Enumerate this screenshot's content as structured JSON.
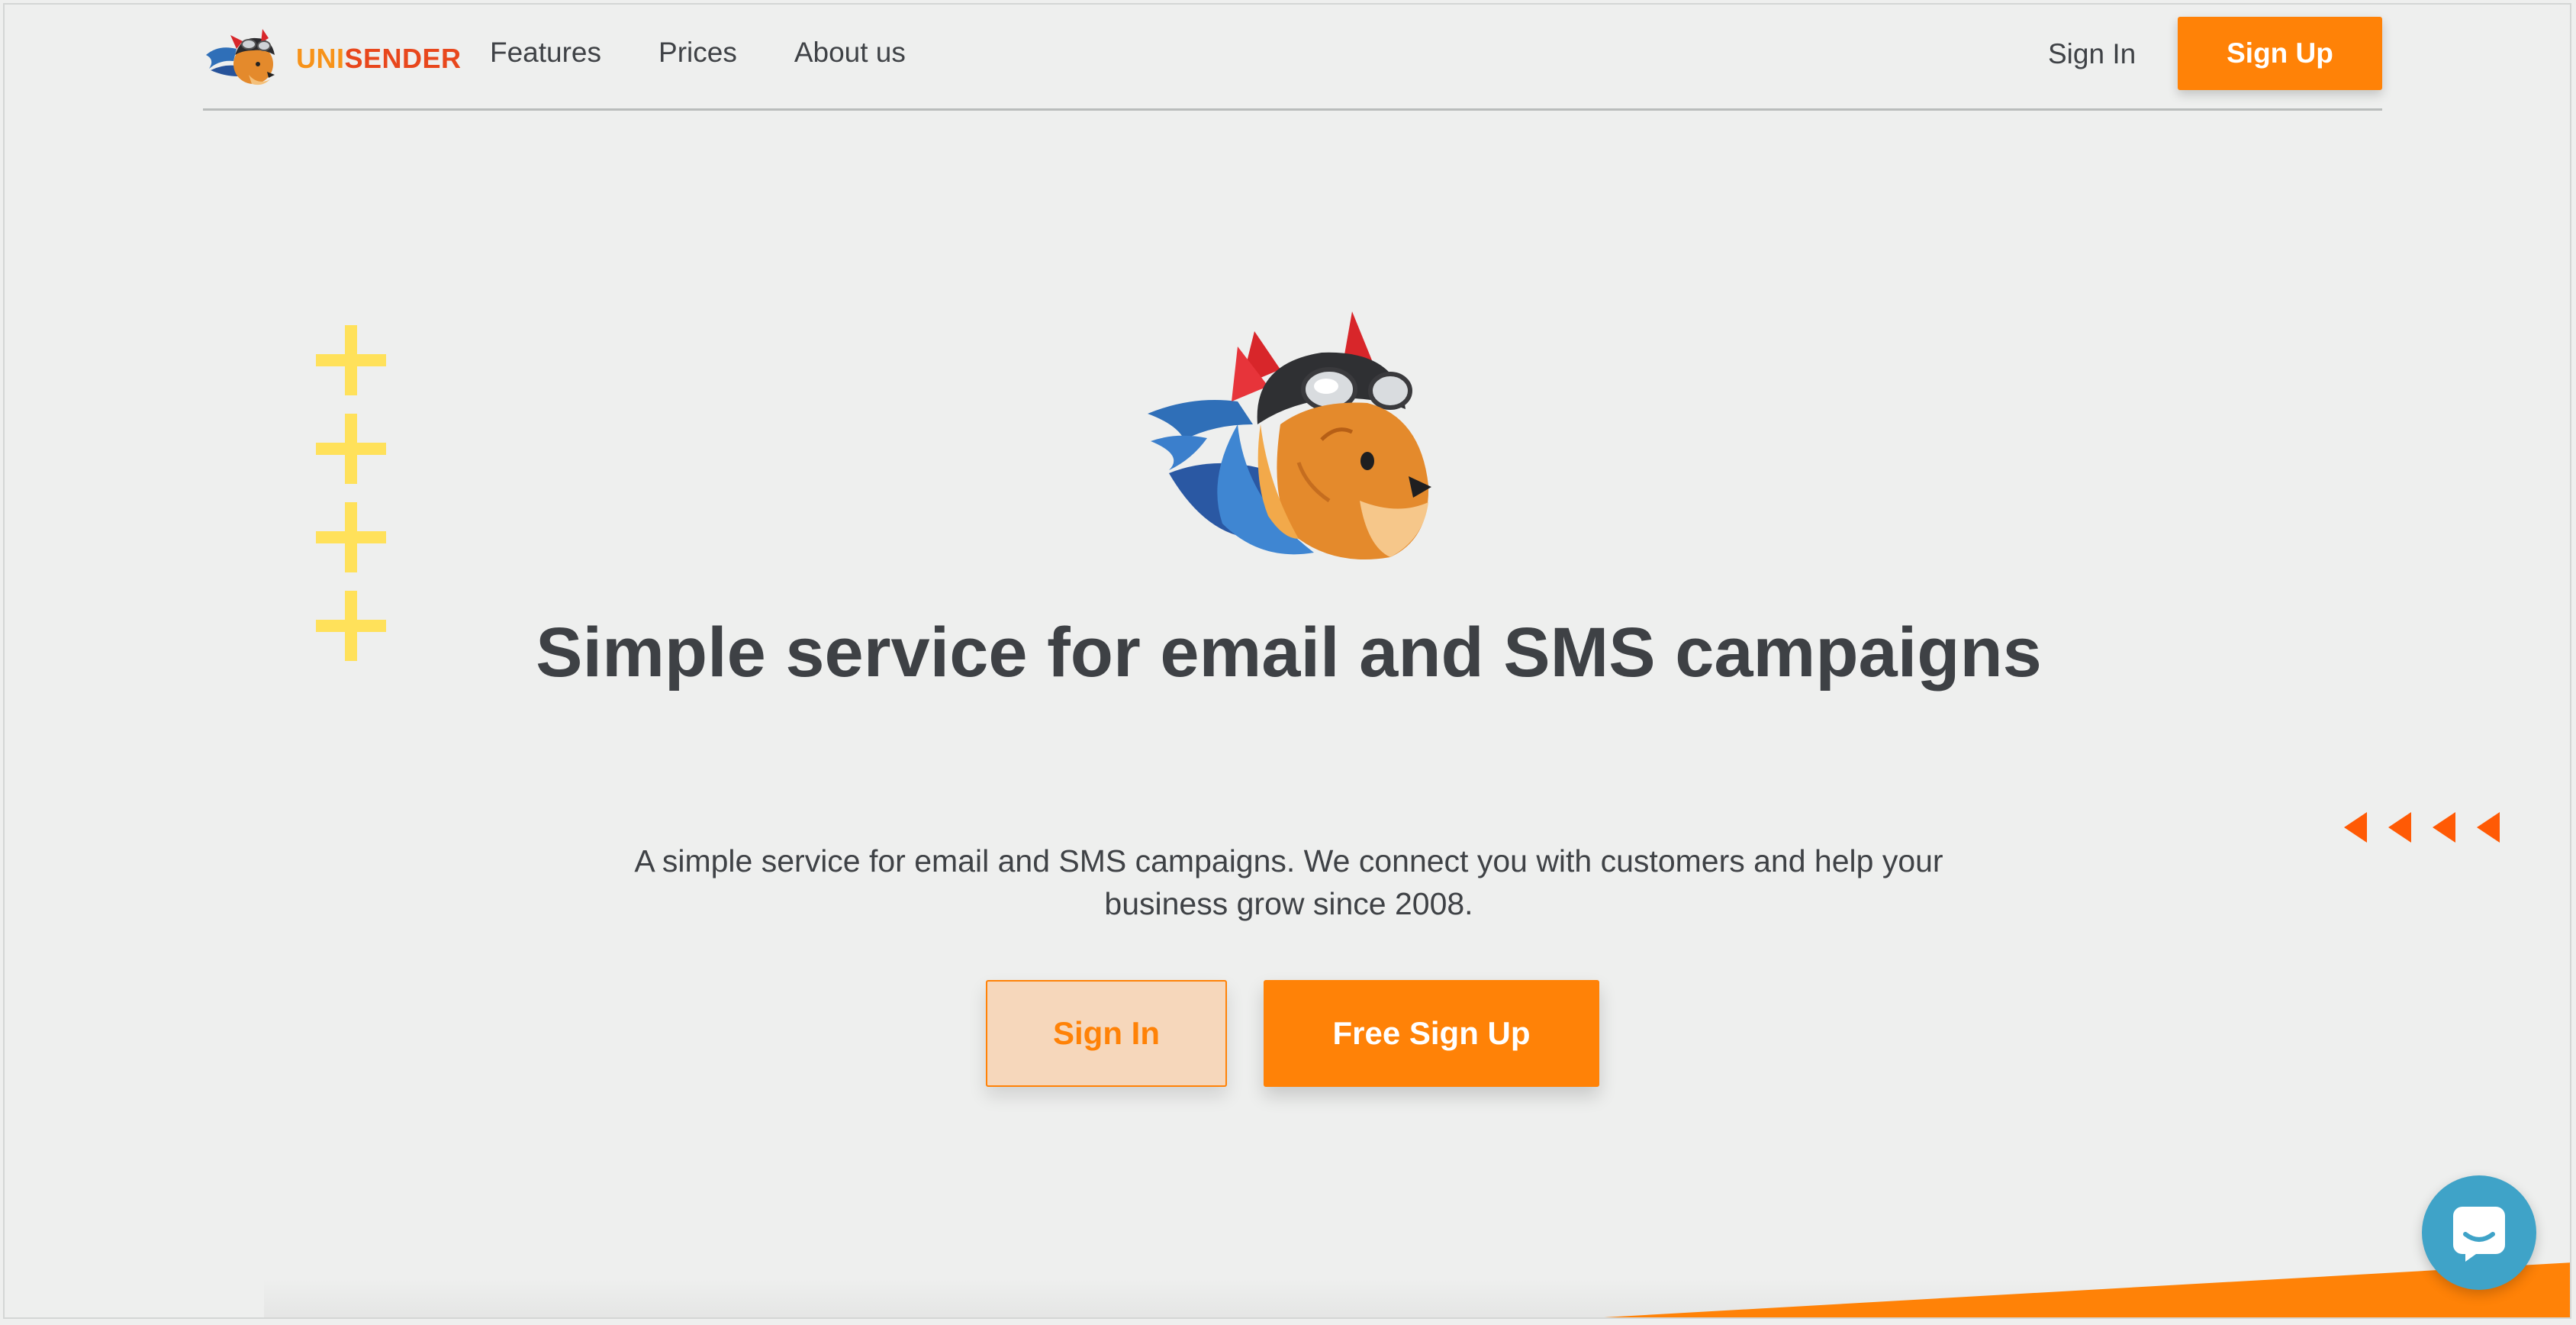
{
  "header": {
    "brand_uni": "UNI",
    "brand_sender": "SENDER",
    "nav": [
      "Features",
      "Prices",
      "About us"
    ],
    "sign_in": "Sign In",
    "sign_up": "Sign Up"
  },
  "hero": {
    "title": "Simple service for email and SMS campaigns",
    "subtitle": "A simple service for email and SMS campaigns. We connect you with customers and help your business grow since 2008.",
    "sign_in_button": "Sign In",
    "free_sign_up_button": "Free Sign Up"
  },
  "icons": {
    "logo": "mascot-logo-icon",
    "hero": "mascot-icon",
    "chat": "chat-icon",
    "plus": "plus-icon",
    "arrow": "arrow-left-icon"
  },
  "colors": {
    "accent": "#ff8207",
    "brand_uni": "#f7931a",
    "brand_sender": "#e8471c",
    "plus": "#ffe15a",
    "arrows": "#ff5a05",
    "chat": "#3fa3c8",
    "background": "#eeefee",
    "text": "#3e4145"
  }
}
